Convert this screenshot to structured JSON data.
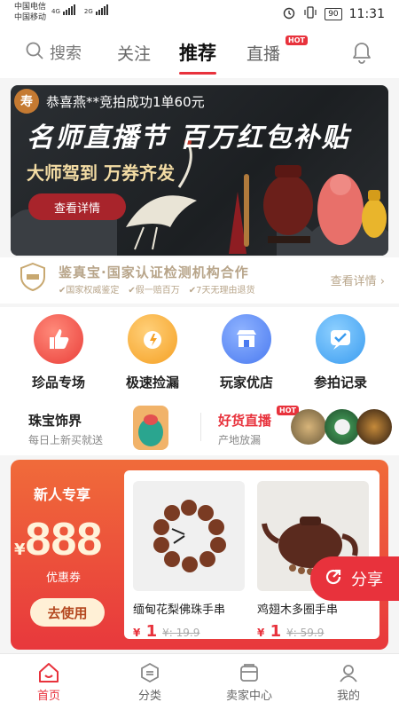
{
  "status_bar": {
    "carrier1": "中国电信",
    "carrier2": "中国移动",
    "net1": "4G",
    "net2": "2G",
    "battery": "90",
    "time": "11:31"
  },
  "top_nav": {
    "search_label": "搜索",
    "tabs": [
      {
        "label": "关注"
      },
      {
        "label": "推荐"
      },
      {
        "label": "直播",
        "badge": "HOT"
      }
    ]
  },
  "banner": {
    "avatar_char": "寿",
    "notification": "恭喜燕**竞拍成功1单60元",
    "title": "名师直播节 百万红包补贴",
    "subtitle": "大师驾到 万券齐发",
    "button": "查看详情"
  },
  "certification": {
    "title": "鉴真宝·国家认证检测机构合作",
    "tags": [
      "国家权威鉴定",
      "假一赔百万",
      "7天无理由退货"
    ],
    "link": "查看详情"
  },
  "quick_entries": [
    {
      "label": "珍品专场",
      "icon": "thumbs-up-icon"
    },
    {
      "label": "极速捡漏",
      "icon": "alarm-clock-icon"
    },
    {
      "label": "玩家优店",
      "icon": "store-icon"
    },
    {
      "label": "参拍记录",
      "icon": "checkmark-chat-icon"
    }
  ],
  "promos": {
    "left_title": "珠宝饰界",
    "left_sub": "每日上新买就送",
    "right_title": "好货直播",
    "right_badge": "HOT",
    "right_sub": "产地放漏"
  },
  "newbie": {
    "title": "新人专享",
    "currency": "¥",
    "amount": "888",
    "coupon_label": "优惠券",
    "button": "去使用",
    "products": [
      {
        "name": "缅甸花梨佛珠手串",
        "price_currency": "¥",
        "price": "1",
        "old_price": "¥: 19.9"
      },
      {
        "name": "鸡翅木多圈手串",
        "price_currency": "¥",
        "price": "1",
        "old_price": "¥: 59.9"
      }
    ]
  },
  "share": {
    "label": "分享"
  },
  "tab_bar": [
    {
      "label": "首页"
    },
    {
      "label": "分类"
    },
    {
      "label": "卖家中心"
    },
    {
      "label": "我的"
    }
  ],
  "colors": {
    "accent": "#e8323c",
    "gold": "#b8a58a",
    "banner_bg": "#2b2f33"
  }
}
